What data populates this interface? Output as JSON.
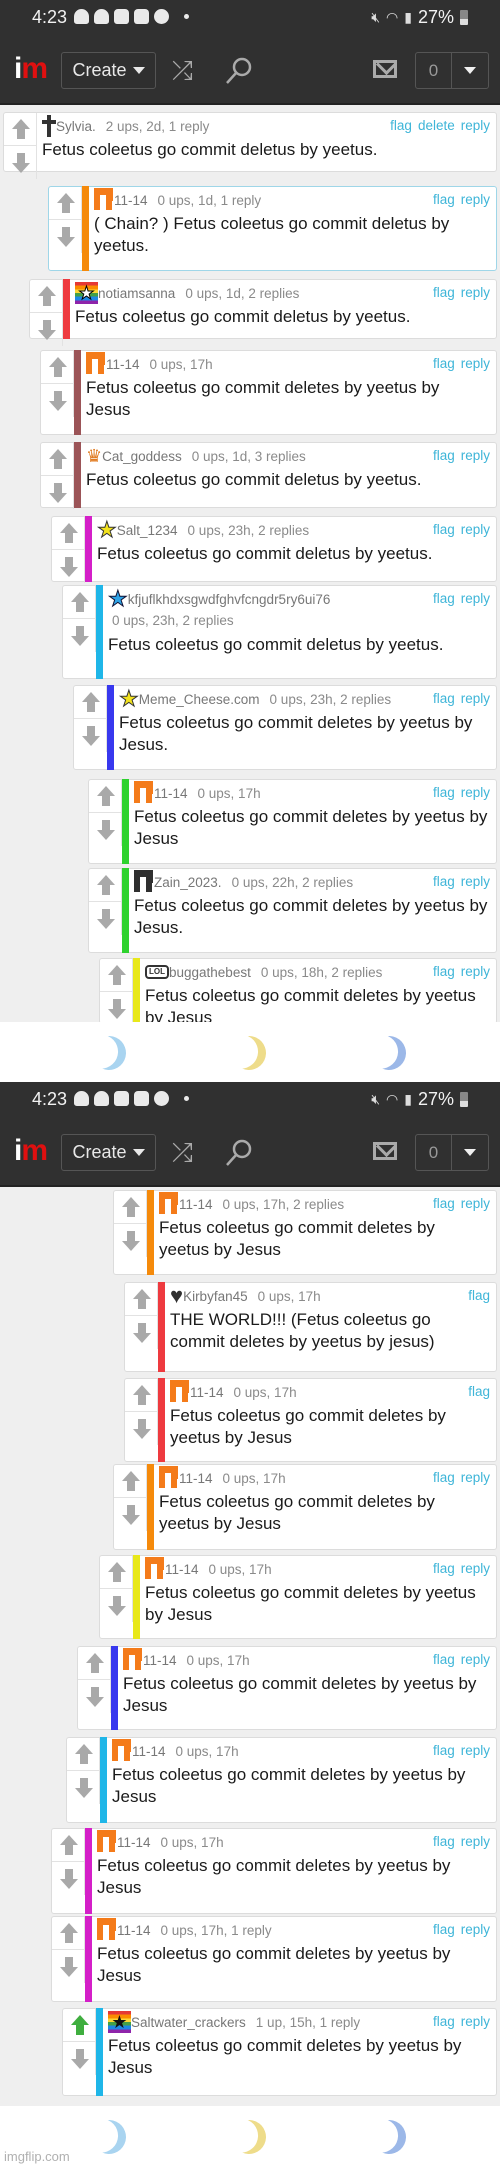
{
  "status_bar": {
    "time": "4:23",
    "notification_icons": [
      "snapchat-icon",
      "snapchat-icon",
      "shopping-bag-icon",
      "shopping-bag-icon",
      "spotify-icon",
      "dot-icon"
    ],
    "system_icons": [
      "mute-icon",
      "wifi-icon",
      "signal-icon"
    ],
    "battery": "27%"
  },
  "navbar": {
    "logo_i": "i",
    "logo_m": "m",
    "create_label": "Create",
    "shuffle_icon": "⤮",
    "search_icon": "⚲",
    "notification_count": "0"
  },
  "colors": {
    "link": "#3eb5d8",
    "navbar_bg": "#303030",
    "logo_accent": "#e01010",
    "upvote_active": "#3fae3f"
  },
  "screens": [
    {
      "comments": [
        {
          "username": "Sylvia.",
          "meta": "2 ups, 2d, 1 reply",
          "actions": [
            "flag",
            "delete",
            "reply"
          ],
          "text": "Fetus coleetus go commit deletus by yeetus.",
          "avatar": "cross-icon",
          "stripe": ""
        },
        {
          "username": "11-14",
          "meta": "0 ups, 1d, 1 reply",
          "actions": [
            "flag",
            "reply"
          ],
          "text": "( Chain? ) Fetus coleetus go commit deletus by yeetus.",
          "avatar": "pixel-orange-icon",
          "stripe": "#f58a0b",
          "highlight": true
        },
        {
          "username": "notiamsanna",
          "meta": "0 ups, 1d, 2 replies",
          "actions": [
            "flag",
            "reply"
          ],
          "text": "Fetus coleetus go commit deletus by yeetus.",
          "avatar": "rainbow-star-icon",
          "stripe": "#ee3a3f"
        },
        {
          "username": "11-14",
          "meta": "0 ups, 17h",
          "actions": [
            "flag",
            "reply"
          ],
          "text": "Fetus coleetus go commit deletes by yeetus by Jesus",
          "avatar": "pixel-orange-icon",
          "stripe": "#9b5457"
        },
        {
          "username": "Cat_goddess",
          "meta": "0 ups, 1d, 3 replies",
          "actions": [
            "flag",
            "reply"
          ],
          "text": "Fetus coleetus go commit deletus by yeetus.",
          "avatar": "crown-icon",
          "stripe": "#9b5457"
        },
        {
          "username": "Salt_1234",
          "meta": "0 ups, 23h, 2 replies",
          "actions": [
            "flag",
            "reply"
          ],
          "text": "Fetus coleetus go commit deletus by yeetus.",
          "avatar": "yellow-star-icon",
          "stripe": "#d41fc8"
        },
        {
          "username": "kfjuflkhdxsgwdfghvfcngdr5ry6ui76",
          "meta": "0 ups, 23h, 2 replies",
          "actions": [
            "flag",
            "reply"
          ],
          "text": "Fetus coleetus go commit deletus by yeetus.",
          "avatar": "blue-star-icon",
          "stripe": "#1fb6e8",
          "meta_wrap": true
        },
        {
          "username": "Meme_Cheese.com",
          "meta": "0 ups, 23h, 2 replies",
          "actions": [
            "flag",
            "reply"
          ],
          "text": "Fetus coleetus go commit deletes by yeetus by Jesus.",
          "avatar": "yellow-star-icon",
          "stripe": "#3838ee"
        },
        {
          "username": "11-14",
          "meta": "0 ups, 17h",
          "actions": [
            "flag",
            "reply"
          ],
          "text": "Fetus coleetus go commit deletes by yeetus by Jesus",
          "avatar": "pixel-orange-icon",
          "stripe": "#2ed22e"
        },
        {
          "username": "Zain_2023.",
          "meta": "0 ups, 22h, 2 replies",
          "actions": [
            "flag",
            "reply"
          ],
          "text": "Fetus coleetus go commit deletes by yeetus by Jesus.",
          "avatar": "pixel-dark-icon",
          "stripe": "#2ed22e"
        },
        {
          "username": "buggathebest",
          "meta": "0 ups, 18h, 2 replies",
          "actions": [
            "flag",
            "reply"
          ],
          "text": "Fetus coleetus go commit deletes by yeetus by Jesus",
          "avatar": "lol-bubble-icon",
          "stripe": "#e8e81a"
        }
      ]
    },
    {
      "comments": [
        {
          "username": "11-14",
          "meta": "0 ups, 17h, 2 replies",
          "actions": [
            "flag",
            "reply"
          ],
          "text": "Fetus coleetus go commit deletes by yeetus by Jesus",
          "avatar": "pixel-orange-icon",
          "stripe": "#f58a0b"
        },
        {
          "username": "Kirbyfan45",
          "meta": "0 ups, 17h",
          "actions": [
            "flag"
          ],
          "text": "THE WORLD!!! (Fetus coleetus go commit deletes by yeetus by jesus)",
          "avatar": "heart-icon",
          "stripe": "#ee3a3f"
        },
        {
          "username": "11-14",
          "meta": "0 ups, 17h",
          "actions": [
            "flag"
          ],
          "text": "Fetus coleetus go commit deletes by yeetus by Jesus",
          "avatar": "pixel-orange-icon",
          "stripe": "#ee3a3f"
        },
        {
          "username": "11-14",
          "meta": "0 ups, 17h",
          "actions": [
            "flag",
            "reply"
          ],
          "text": "Fetus coleetus go commit deletes by yeetus by Jesus",
          "avatar": "pixel-orange-icon",
          "stripe": "#f58a0b"
        },
        {
          "username": "11-14",
          "meta": "0 ups, 17h",
          "actions": [
            "flag",
            "reply"
          ],
          "text": "Fetus coleetus go commit deletes by yeetus by Jesus",
          "avatar": "pixel-orange-icon",
          "stripe": "#e8e81a"
        },
        {
          "username": "11-14",
          "meta": "0 ups, 17h",
          "actions": [
            "flag",
            "reply"
          ],
          "text": "Fetus coleetus go commit deletes by yeetus by Jesus",
          "avatar": "pixel-orange-icon",
          "stripe": "#3838ee"
        },
        {
          "username": "11-14",
          "meta": "0 ups, 17h",
          "actions": [
            "flag",
            "reply"
          ],
          "text": "Fetus coleetus go commit deletes by yeetus by Jesus",
          "avatar": "pixel-orange-icon",
          "stripe": "#1fb6e8"
        },
        {
          "username": "11-14",
          "meta": "0 ups, 17h",
          "actions": [
            "flag",
            "reply"
          ],
          "text": "Fetus coleetus go commit deletes by yeetus by Jesus",
          "avatar": "pixel-orange-icon",
          "stripe": "#d41fc8"
        },
        {
          "username": "11-14",
          "meta": "0 ups, 17h, 1 reply",
          "actions": [
            "flag",
            "reply"
          ],
          "text": "Fetus coleetus go commit deletes by yeetus by Jesus",
          "avatar": "pixel-orange-icon",
          "stripe": "#d41fc8"
        },
        {
          "username": "Saltwater_crackers",
          "meta": "1 up, 15h, 1 reply",
          "actions": [
            "flag",
            "reply"
          ],
          "text": "Fetus coleetus go commit deletes by yeetus by Jesus",
          "avatar": "rainbow-black-star-icon",
          "stripe": "#1fb6e8",
          "upvoted": true
        }
      ]
    }
  ],
  "footer": {
    "moons": [
      "#a9d4f0",
      "#eedc8a",
      "#9cb8e8"
    ],
    "watermark": "imgflip.com"
  }
}
